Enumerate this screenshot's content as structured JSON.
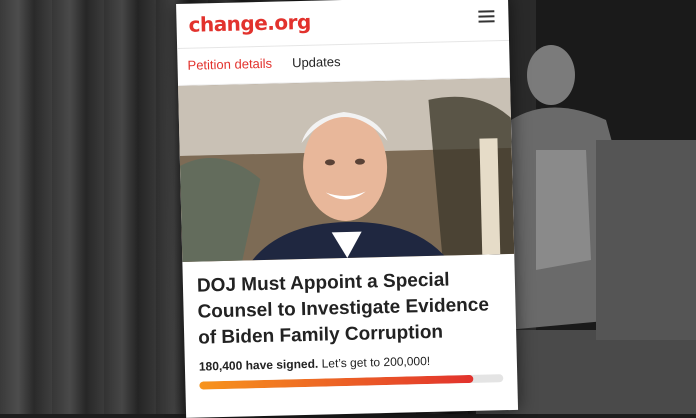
{
  "site": {
    "logo_text": "change.org",
    "brand_color": "#e2322d"
  },
  "header": {
    "menu_icon": "hamburger-menu-icon"
  },
  "tabs": [
    {
      "label": "Petition details",
      "active": true
    },
    {
      "label": "Updates",
      "active": false
    }
  ],
  "petition": {
    "title": "DOJ Must Appoint a Special Counsel to Investigate Evidence of Biden Family Corruption",
    "signed_count": "180,400 have signed.",
    "goal_text": "Let’s get to 200,000!",
    "progress_fraction": 0.902
  }
}
